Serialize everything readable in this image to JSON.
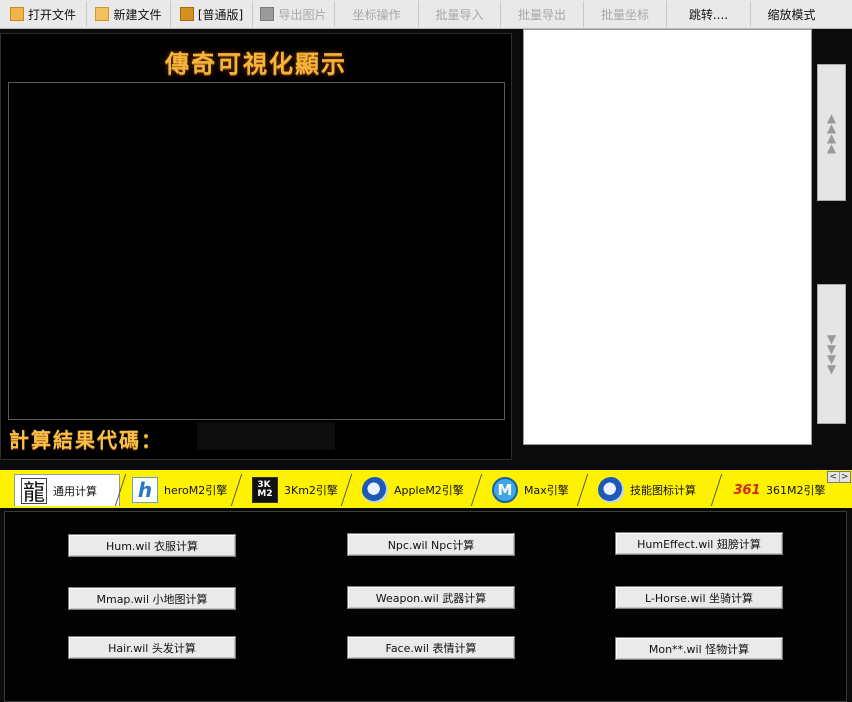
{
  "toolbar": {
    "items": [
      {
        "label": "打开文件",
        "icon": "folder-icon",
        "enabled": true
      },
      {
        "label": "新建文件",
        "icon": "new-file-icon",
        "enabled": true
      },
      {
        "label": "[普通版]",
        "icon": "mode-icon",
        "enabled": true
      },
      {
        "label": "导出图片",
        "icon": "image-icon",
        "enabled": false
      },
      {
        "label": "坐标操作",
        "enabled": false
      },
      {
        "label": "批量导入",
        "enabled": false
      },
      {
        "label": "批量导出",
        "enabled": false
      },
      {
        "label": "批量坐标",
        "enabled": false
      },
      {
        "label": "跳转....",
        "enabled": true
      },
      {
        "label": "缩放模式",
        "enabled": true
      }
    ]
  },
  "display": {
    "title": "傳奇可視化顯示",
    "result_label": "計算結果代碼：",
    "result_value": ""
  },
  "preview": {
    "scroll_up_icon": "triangle-up-icon",
    "scroll_down_icon": "triangle-down-icon"
  },
  "tabs": [
    {
      "label": "通用计算",
      "icon": "dragon-icon",
      "active": true
    },
    {
      "label": "heroM2引擎",
      "icon": "hero-logo-icon",
      "active": false
    },
    {
      "label": "3Km2引擎",
      "icon": "3k-logo-icon",
      "active": false
    },
    {
      "label": "AppleM2引擎",
      "icon": "swirl-logo-icon",
      "active": false
    },
    {
      "label": "Max引擎",
      "icon": "max-logo-icon",
      "active": false
    },
    {
      "label": "技能图标计算",
      "icon": "swirl-logo-icon",
      "active": false
    },
    {
      "label": "361M2引擎",
      "icon": "361-logo-icon",
      "active": false
    }
  ],
  "calc_buttons": [
    {
      "label": "Hum.wil 衣服计算"
    },
    {
      "label": "Npc.wil Npc计算"
    },
    {
      "label": "HumEffect.wil 翅膀计算"
    },
    {
      "label": "Mmap.wil 小地图计算"
    },
    {
      "label": "Weapon.wil 武器计算"
    },
    {
      "label": "L-Horse.wil 坐骑计算"
    },
    {
      "label": "Hair.wil 头发计算"
    },
    {
      "label": "Face.wil 表情计算"
    },
    {
      "label": "Mon**.wil 怪物计算"
    }
  ],
  "colors": {
    "accent_gold": "#f4b53a",
    "tab_strip": "#fff200",
    "panel_bg": "#000000"
  }
}
